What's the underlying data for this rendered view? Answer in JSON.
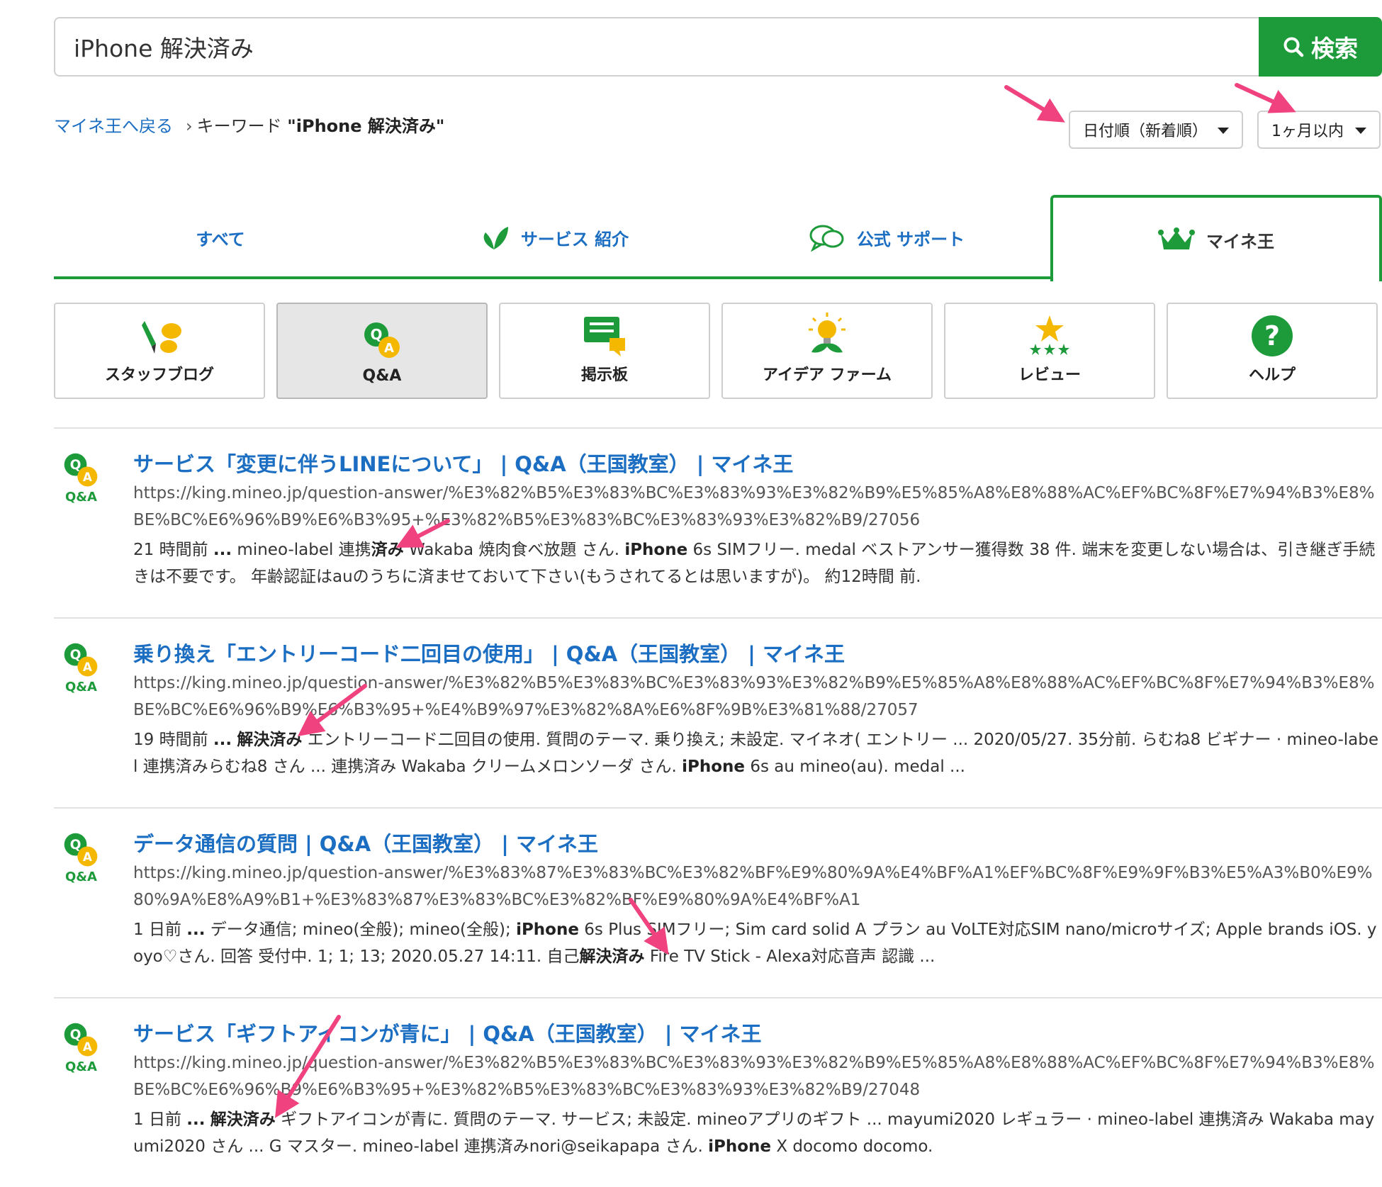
{
  "search": {
    "value": "iPhone 解決済み",
    "button_label": "検索"
  },
  "breadcrumb": {
    "back_link": "マイネ王へ戻る",
    "separator": "›",
    "prefix": "キーワード",
    "keyword": "\"iPhone 解決済み\""
  },
  "sort": {
    "selected": "日付順（新着順）"
  },
  "period": {
    "selected": "1ヶ月以内"
  },
  "tabs": [
    {
      "label": "すべて"
    },
    {
      "label": "サービス 紹介"
    },
    {
      "label": "公式 サポート"
    },
    {
      "label": "マイネ王"
    }
  ],
  "categories": [
    {
      "label": "スタッフブログ"
    },
    {
      "label": "Q&A"
    },
    {
      "label": "掲示板"
    },
    {
      "label": "アイデア ファーム"
    },
    {
      "label": "レビュー"
    },
    {
      "label": "ヘルプ"
    }
  ],
  "result_icon_label": "Q&A",
  "results": [
    {
      "title": "サービス「変更に伴うLINEについて」 | Q&A（王国教室） | マイネ王",
      "url": "https://king.mineo.jp/question-answer/%E3%82%B5%E3%83%BC%E3%83%93%E3%82%B9%E5%85%A8%E8%88%AC%EF%BC%8F%E7%94%B3%E8%BE%BC%E6%96%B9%E6%B3%95+%E3%82%B5%E3%83%BC%E3%83%93%E3%82%B9/27056",
      "snippet": [
        "21 時間前 ",
        "...",
        " mineo-label 連携",
        "済み",
        " Wakaba 焼肉食べ放題 さん. ",
        "iPhone",
        " 6s SIMフリー. medal ベストアンサー獲得数 38 件. 端末を変更しない場合は、引き継ぎ手続きは不要です。 年齢認証はauのうちに済ませておいて下さい(もうされてるとは思いますが)。 約12時間 前."
      ]
    },
    {
      "title": "乗り換え「エントリーコード二回目の使用」 | Q&A（王国教室） | マイネ王",
      "url": "https://king.mineo.jp/question-answer/%E3%82%B5%E3%83%BC%E3%83%93%E3%82%B9%E5%85%A8%E8%88%AC%EF%BC%8F%E7%94%B3%E8%BE%BC%E6%96%B9%E6%B3%95+%E4%B9%97%E3%82%8A%E6%8F%9B%E3%81%88/27057",
      "snippet": [
        "19 時間前 ",
        "...",
        " ",
        "解決済み",
        " エントリーコード二回目の使用. 質問のテーマ. 乗り換え; 未設定. マイネオ( エントリー ... 2020/05/27. 35分前. らむね8 ビギナー · mineo-label 連携済みらむね8 さん ... 連携済み Wakaba クリームメロンソーダ さん. ",
        "iPhone",
        " 6s au mineo(au). medal  ..."
      ]
    },
    {
      "title": "データ通信の質問 | Q&A（王国教室） | マイネ王",
      "url": "https://king.mineo.jp/question-answer/%E3%83%87%E3%83%BC%E3%82%BF%E9%80%9A%E4%BF%A1%EF%BC%8F%E9%9F%B3%E5%A3%B0%E9%80%9A%E8%A9%B1+%E3%83%87%E3%83%BC%E3%82%BF%E9%80%9A%E4%BF%A1",
      "snippet": [
        "1 日前 ",
        "...",
        " データ通信; mineo(全般); mineo(全般); ",
        "iPhone",
        " 6s Plus SIMフリー; Sim card solid A プラン au VoLTE対応SIM nano/microサイズ; Apple brands iOS. yoyo♡さん. 回答 受付中. 1; 1; 13; 2020.05.27 14:11. 自己",
        "解決済み",
        " Fire TV Stick - Alexa対応音声 認識 ..."
      ]
    },
    {
      "title": "サービス「ギフトアイコンが青に」 | Q&A（王国教室） | マイネ王",
      "url": "https://king.mineo.jp/question-answer/%E3%82%B5%E3%83%BC%E3%83%93%E3%82%B9%E5%85%A8%E8%88%AC%EF%BC%8F%E7%94%B3%E8%BE%BC%E6%96%B9%E6%B3%95+%E3%82%B5%E3%83%BC%E3%83%93%E3%82%B9/27048",
      "snippet": [
        "1 日前 ",
        "...",
        " ",
        "解決済み",
        " ギフトアイコンが青に. 質問のテーマ. サービス; 未設定. mineoアプリのギフト ... mayumi2020 レギュラー · mineo-label 連携済み Wakaba mayumi2020 さん ... G マスター. mineo-label 連携済みnori@seikapapa さん. ",
        "iPhone",
        " X docomo docomo."
      ]
    }
  ],
  "colors": {
    "brand_green": "#1d9a3a",
    "link_blue": "#1b6ec2",
    "annotation_arrow": "#f0427e",
    "qa_yellow": "#f5b800"
  }
}
